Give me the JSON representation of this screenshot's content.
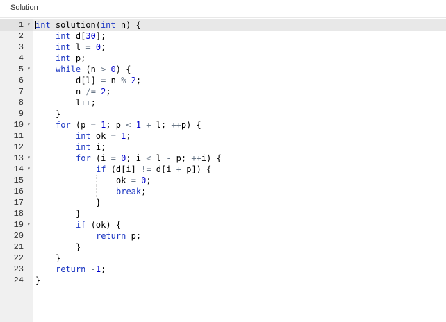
{
  "header": {
    "title": "Solution"
  },
  "editor": {
    "active_line": 1,
    "lines": [
      {
        "n": "1",
        "fold": true,
        "indent": 0,
        "text": "int solution(int n) {"
      },
      {
        "n": "2",
        "fold": false,
        "indent": 1,
        "text": "int d[30];"
      },
      {
        "n": "3",
        "fold": false,
        "indent": 1,
        "text": "int l = 0;"
      },
      {
        "n": "4",
        "fold": false,
        "indent": 1,
        "text": "int p;"
      },
      {
        "n": "5",
        "fold": true,
        "indent": 1,
        "text": "while (n > 0) {"
      },
      {
        "n": "6",
        "fold": false,
        "indent": 2,
        "text": "d[l] = n % 2;"
      },
      {
        "n": "7",
        "fold": false,
        "indent": 2,
        "text": "n /= 2;"
      },
      {
        "n": "8",
        "fold": false,
        "indent": 2,
        "text": "l++;"
      },
      {
        "n": "9",
        "fold": false,
        "indent": 1,
        "text": "}"
      },
      {
        "n": "10",
        "fold": true,
        "indent": 1,
        "text": "for (p = 1; p < 1 + l; ++p) {"
      },
      {
        "n": "11",
        "fold": false,
        "indent": 2,
        "text": "int ok = 1;"
      },
      {
        "n": "12",
        "fold": false,
        "indent": 2,
        "text": "int i;"
      },
      {
        "n": "13",
        "fold": true,
        "indent": 2,
        "text": "for (i = 0; i < l - p; ++i) {"
      },
      {
        "n": "14",
        "fold": true,
        "indent": 3,
        "text": "if (d[i] != d[i + p]) {"
      },
      {
        "n": "15",
        "fold": false,
        "indent": 4,
        "text": "ok = 0;"
      },
      {
        "n": "16",
        "fold": false,
        "indent": 4,
        "text": "break;"
      },
      {
        "n": "17",
        "fold": false,
        "indent": 3,
        "text": "}"
      },
      {
        "n": "18",
        "fold": false,
        "indent": 2,
        "text": "}"
      },
      {
        "n": "19",
        "fold": true,
        "indent": 2,
        "text": "if (ok) {"
      },
      {
        "n": "20",
        "fold": false,
        "indent": 3,
        "text": "return p;"
      },
      {
        "n": "21",
        "fold": false,
        "indent": 2,
        "text": "}"
      },
      {
        "n": "22",
        "fold": false,
        "indent": 1,
        "text": "}"
      },
      {
        "n": "23",
        "fold": false,
        "indent": 1,
        "text": "return -1;"
      },
      {
        "n": "24",
        "fold": false,
        "indent": 0,
        "text": "}"
      }
    ]
  },
  "colors": {
    "keyword": "#1b36c2",
    "number": "#0000cd",
    "operator": "#687687",
    "gutter": "#f0f0f0"
  },
  "icons": {
    "fold": "fold-arrow-icon"
  }
}
